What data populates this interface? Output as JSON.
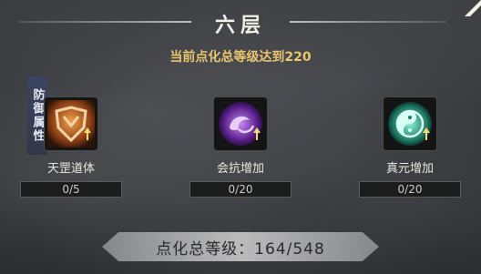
{
  "layer": {
    "title": "六层",
    "condition": "当前点化总等级达到220"
  },
  "category": {
    "label": "防御属性"
  },
  "skills": [
    {
      "name": "天罡道体",
      "progress": "0/5",
      "icon": "armor-shield-icon",
      "color": "#e08a3a"
    },
    {
      "name": "会抗增加",
      "progress": "0/20",
      "icon": "purple-swirl-icon",
      "color": "#9a4fd6"
    },
    {
      "name": "真元增加",
      "progress": "0/20",
      "icon": "teal-yinyang-icon",
      "color": "#3fb59a"
    }
  ],
  "summary": {
    "label": "点化总等级：164/548"
  }
}
